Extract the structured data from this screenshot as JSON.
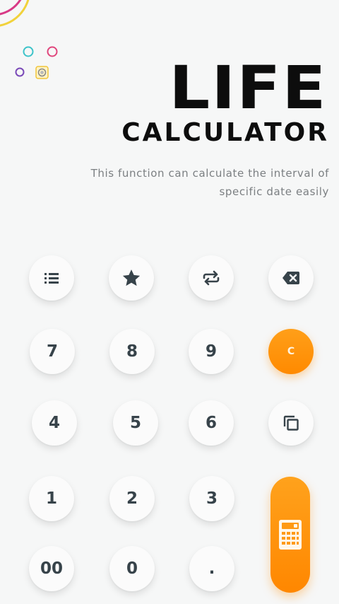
{
  "header": {
    "title_line1": "LIFE",
    "title_line2": "CALCULATOR",
    "description_line1": "This function can calculate the interval of",
    "description_line2": "specific date easily"
  },
  "keypad": {
    "tools": [
      "list-icon",
      "star-icon",
      "swap-icon",
      "backspace-icon"
    ],
    "row1": [
      "7",
      "8",
      "9"
    ],
    "clear_label": "C",
    "row2": [
      "4",
      "5",
      "6"
    ],
    "copy_icon": "copy-icon",
    "row3": [
      "1",
      "2",
      "3"
    ],
    "row4": [
      "00",
      "0",
      "."
    ],
    "calculate_icon": "calculator-icon"
  },
  "colors": {
    "accent": "#ff8c00",
    "text_dark": "#0d0d0d",
    "key_text": "#37434a",
    "desc_text": "#7b7f82",
    "background": "#f6f7f7"
  }
}
